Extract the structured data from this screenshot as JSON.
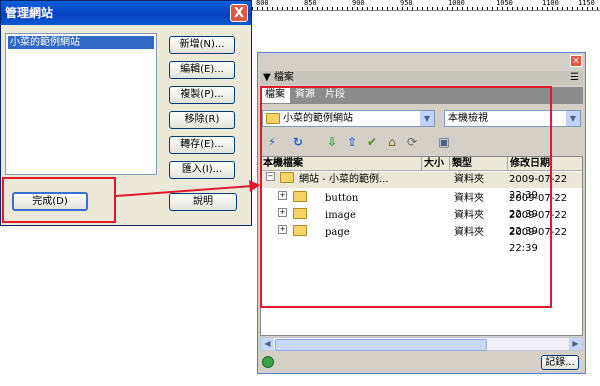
{
  "dialog": {
    "title": "管理網站",
    "close_glyph": "X",
    "sites": [
      "小菜的範例網站"
    ],
    "buttons": {
      "new": "新增(N)...",
      "edit": "編輯(E)...",
      "copy": "複製(P)...",
      "remove": "移除(R)",
      "export": "轉存(E)...",
      "import": "匯入(I)...",
      "done": "完成(D)",
      "help": "說明"
    }
  },
  "ruler": {
    "labels": [
      "800",
      "850",
      "900",
      "950",
      "1000",
      "1050",
      "1100",
      "1150"
    ]
  },
  "files_panel": {
    "title": "▼ 檔案",
    "options_glyph": "☰",
    "tabs": [
      "檔案",
      "資源",
      "片段"
    ],
    "site_selector": "小菜的範例網站",
    "view_selector": "本機檢視",
    "toolbar_icons": [
      "connect-icon",
      "refresh-icon",
      "get-icon",
      "put-icon",
      "check-out-icon",
      "check-in-icon",
      "sync-icon",
      "expand-icon"
    ],
    "columns": [
      "本機檔案",
      "大小",
      "類型",
      "修改日期"
    ],
    "rows": [
      {
        "name": "網站 - 小菜的範例...",
        "type": "資料夾",
        "date": "2009-07-22 22:39"
      },
      {
        "name": "button",
        "type": "資料夾",
        "date": "2009-07-22 22:39"
      },
      {
        "name": "image",
        "type": "資料夾",
        "date": "2009-07-22 22:39"
      },
      {
        "name": "page",
        "type": "資料夾",
        "date": "2009-07-22 22:39"
      }
    ],
    "log_button": "記錄..."
  },
  "colors": {
    "annotation_red": "#e0192c",
    "xp_blue": "#0a5fd8",
    "selection": "#316ac5"
  }
}
